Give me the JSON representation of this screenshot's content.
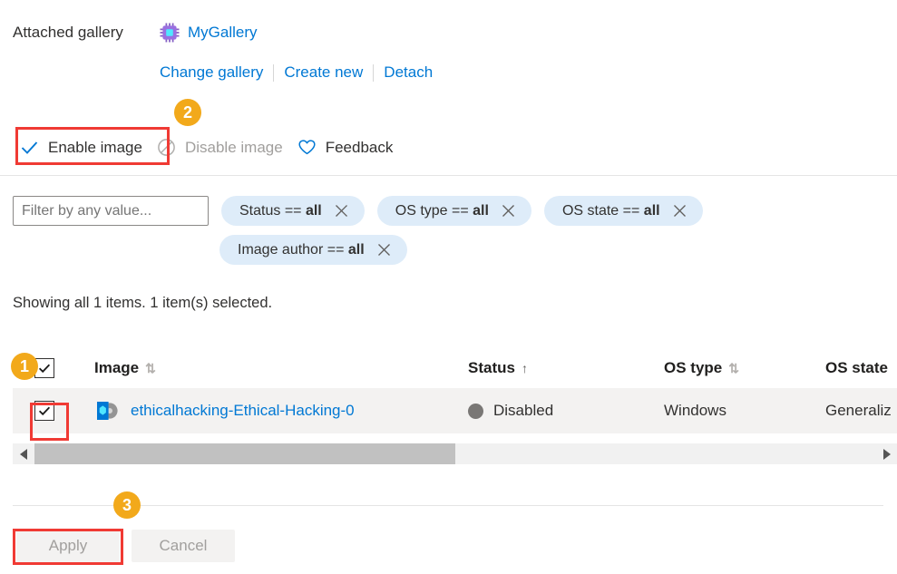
{
  "gallery": {
    "label": "Attached gallery",
    "name": "MyGallery",
    "icon": "gallery-chip-icon",
    "actions": [
      {
        "label": "Change gallery"
      },
      {
        "label": "Create new"
      },
      {
        "label": "Detach"
      }
    ]
  },
  "commandbar": {
    "items": [
      {
        "label": "Enable image",
        "icon": "checkmark-icon",
        "disabled": false
      },
      {
        "label": "Disable image",
        "icon": "block-icon",
        "disabled": true
      },
      {
        "label": "Feedback",
        "icon": "heart-icon",
        "disabled": false
      }
    ]
  },
  "filters": {
    "search_placeholder": "Filter by any value...",
    "search_value": "",
    "pills": [
      {
        "field": "Status",
        "operator": "==",
        "value": "all"
      },
      {
        "field": "OS type",
        "operator": "==",
        "value": "all"
      },
      {
        "field": "OS state",
        "operator": "==",
        "value": "all"
      },
      {
        "field": "Image author",
        "operator": "==",
        "value": "all"
      }
    ]
  },
  "summary": "Showing all 1 items.  1 item(s) selected.",
  "grid": {
    "header_checkbox_checked": true,
    "columns": [
      {
        "label": "Image",
        "sort": "both"
      },
      {
        "label": "Status",
        "sort": "asc"
      },
      {
        "label": "OS type",
        "sort": "both"
      },
      {
        "label": "OS state",
        "sort": "none"
      }
    ],
    "rows": [
      {
        "checked": true,
        "image": "ethicalhacking-Ethical-Hacking-0",
        "status": "Disabled",
        "os_type": "Windows",
        "os_state": "Generaliz"
      }
    ]
  },
  "scrollbar": {
    "thumb_percent": 50,
    "left_arrow": "◀",
    "right_arrow": "▶"
  },
  "footer": {
    "apply_label": "Apply",
    "cancel_label": "Cancel"
  },
  "annotations": {
    "badge1": "1",
    "badge2": "2",
    "badge3": "3"
  },
  "colors": {
    "accent": "#0078d4",
    "pill_bg": "#deecf9",
    "badge": "#f2a91b",
    "highlight": "#f03a34",
    "status_dot": "#797775",
    "row_bg": "#f3f2f1"
  }
}
